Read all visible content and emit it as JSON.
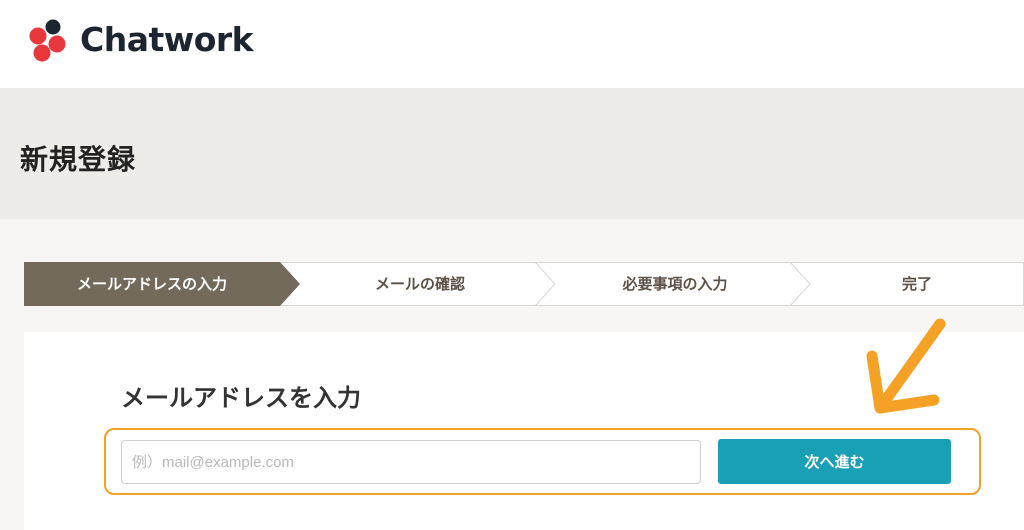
{
  "header": {
    "brand": "Chatwork",
    "colors": {
      "red": "#e8383d",
      "dark": "#1d2630"
    }
  },
  "page": {
    "title": "新規登録"
  },
  "steps": [
    {
      "label": "メールアドレスの入力",
      "active": true
    },
    {
      "label": "メールの確認",
      "active": false
    },
    {
      "label": "必要事項の入力",
      "active": false
    },
    {
      "label": "完了",
      "active": false
    }
  ],
  "form": {
    "heading": "メールアドレスを入力",
    "email_value": "",
    "email_placeholder": "例）mail@example.com",
    "next_label": "次へ進む"
  },
  "colors": {
    "active_step": "#736a5c",
    "button": "#1aa0b6",
    "highlight": "#f4a125"
  }
}
